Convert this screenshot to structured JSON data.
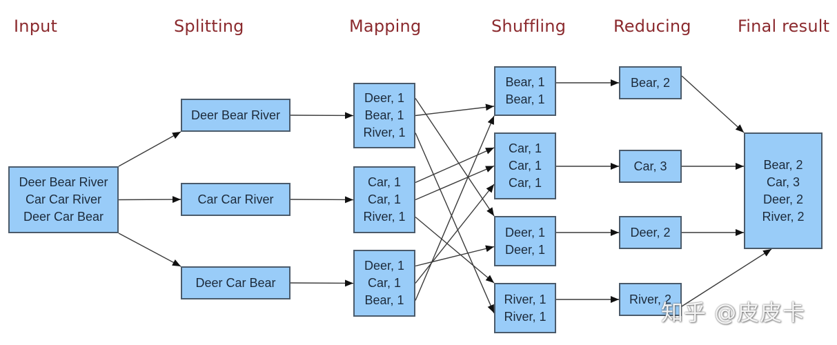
{
  "stages": [
    {
      "key": "input",
      "title": "Input"
    },
    {
      "key": "splitting",
      "title": "Splitting"
    },
    {
      "key": "mapping",
      "title": "Mapping"
    },
    {
      "key": "shuffling",
      "title": "Shuffling"
    },
    {
      "key": "reducing",
      "title": "Reducing"
    },
    {
      "key": "final",
      "title": "Final result"
    }
  ],
  "nodes": {
    "input": [
      {
        "lines": [
          "Deer Bear River",
          "Car Car River",
          "Deer Car Bear"
        ]
      }
    ],
    "splitting": [
      {
        "lines": [
          "Deer Bear River"
        ]
      },
      {
        "lines": [
          "Car Car River"
        ]
      },
      {
        "lines": [
          "Deer Car Bear"
        ]
      }
    ],
    "mapping": [
      {
        "lines": [
          "Deer, 1",
          "Bear, 1",
          "River, 1"
        ]
      },
      {
        "lines": [
          "Car, 1",
          "Car, 1",
          "River, 1"
        ]
      },
      {
        "lines": [
          "Deer, 1",
          "Car, 1",
          "Bear, 1"
        ]
      }
    ],
    "shuffling": [
      {
        "lines": [
          "Bear, 1",
          "Bear, 1"
        ]
      },
      {
        "lines": [
          "Car, 1",
          "Car, 1",
          "Car, 1"
        ]
      },
      {
        "lines": [
          "Deer, 1",
          "Deer, 1"
        ]
      },
      {
        "lines": [
          "River, 1",
          "River, 1"
        ]
      }
    ],
    "reducing": [
      {
        "lines": [
          "Bear, 2"
        ]
      },
      {
        "lines": [
          "Car, 3"
        ]
      },
      {
        "lines": [
          "Deer, 2"
        ]
      },
      {
        "lines": [
          "River, 2"
        ]
      }
    ],
    "final": [
      {
        "lines": [
          "Bear, 2",
          "Car, 3",
          "Deer, 2",
          "River, 2"
        ]
      }
    ]
  },
  "edges": [
    {
      "from": "input.0",
      "to": "splitting.0"
    },
    {
      "from": "input.0",
      "to": "splitting.1"
    },
    {
      "from": "input.0",
      "to": "splitting.2"
    },
    {
      "from": "splitting.0",
      "to": "mapping.0"
    },
    {
      "from": "splitting.1",
      "to": "mapping.1"
    },
    {
      "from": "splitting.2",
      "to": "mapping.2"
    },
    {
      "from": "mapping.0",
      "line": 0,
      "to": "shuffling.2"
    },
    {
      "from": "mapping.0",
      "line": 1,
      "to": "shuffling.0"
    },
    {
      "from": "mapping.0",
      "line": 2,
      "to": "shuffling.3"
    },
    {
      "from": "mapping.1",
      "line": 0,
      "to": "shuffling.1"
    },
    {
      "from": "mapping.1",
      "line": 1,
      "to": "shuffling.1"
    },
    {
      "from": "mapping.1",
      "line": 2,
      "to": "shuffling.3"
    },
    {
      "from": "mapping.2",
      "line": 0,
      "to": "shuffling.2"
    },
    {
      "from": "mapping.2",
      "line": 1,
      "to": "shuffling.1"
    },
    {
      "from": "mapping.2",
      "line": 2,
      "to": "shuffling.0"
    },
    {
      "from": "shuffling.0",
      "to": "reducing.0"
    },
    {
      "from": "shuffling.1",
      "to": "reducing.1"
    },
    {
      "from": "shuffling.2",
      "to": "reducing.2"
    },
    {
      "from": "shuffling.3",
      "to": "reducing.3"
    },
    {
      "from": "reducing.0",
      "to": "final.0"
    },
    {
      "from": "reducing.1",
      "to": "final.0"
    },
    {
      "from": "reducing.2",
      "to": "final.0"
    },
    {
      "from": "reducing.3",
      "to": "final.0"
    }
  ],
  "colors": {
    "title": "#8b2a2e",
    "node_fill": "#99ccf8",
    "node_border": "#4a5a6a",
    "edge": "#3a3a3a"
  },
  "watermark": "知乎 @皮皮卡"
}
